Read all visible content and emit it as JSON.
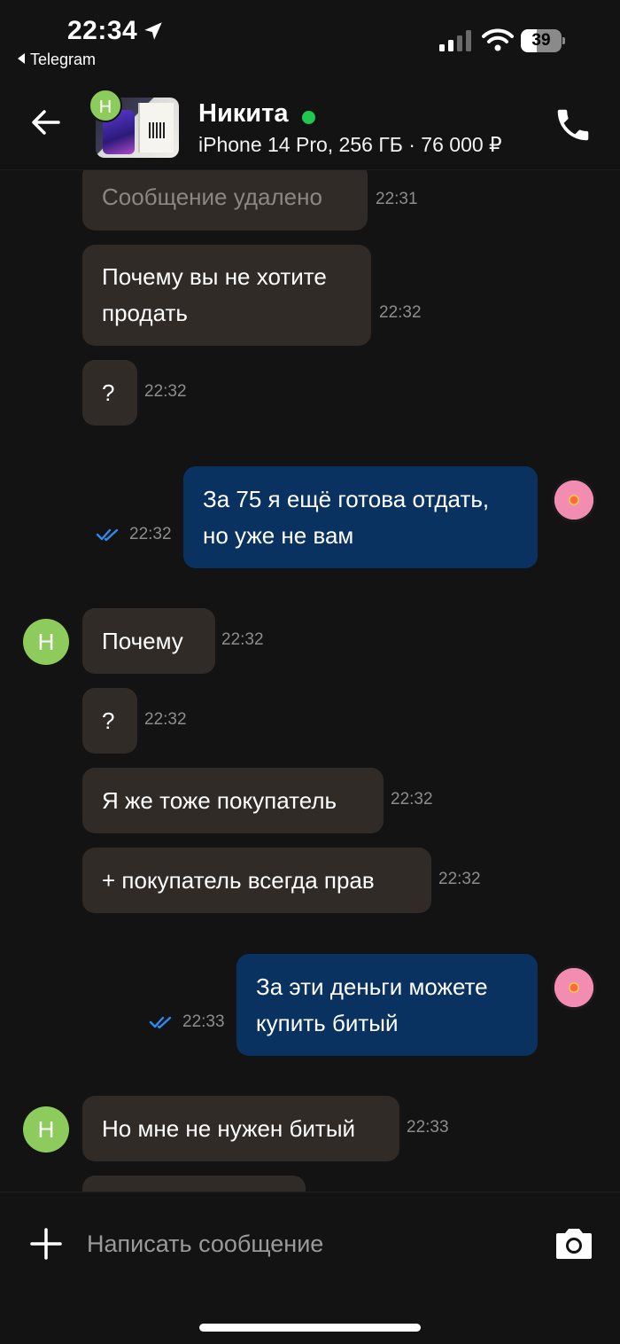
{
  "status_bar": {
    "time": "22:34",
    "back_app": "Telegram",
    "battery_level": "39",
    "battery_fraction": 0.39
  },
  "header": {
    "name": "Никита",
    "listing": "iPhone 14 Pro, 256 ГБ · 76 000 ₽",
    "badge_letter": "Н"
  },
  "messages": [
    {
      "dir": "in",
      "text": "Сообщение удалено",
      "time": "22:31",
      "deleted": true
    },
    {
      "dir": "in",
      "text": "Почему вы не хотите продать",
      "time": "22:32"
    },
    {
      "dir": "in",
      "text": "?",
      "time": "22:32"
    },
    {
      "dir": "out",
      "text": "За 75 я ещё готова отдать, но уже не вам",
      "time": "22:32",
      "status": "read"
    },
    {
      "dir": "in",
      "text": "Почему",
      "time": "22:32",
      "avatar": "Н"
    },
    {
      "dir": "in",
      "text": "?",
      "time": "22:32"
    },
    {
      "dir": "in",
      "text": "Я же тоже покупатель",
      "time": "22:32"
    },
    {
      "dir": "in",
      "text": "+ покупатель всегда прав",
      "time": "22:32"
    },
    {
      "dir": "out",
      "text": "За эти деньги можете купить битый",
      "time": "22:33",
      "status": "read"
    },
    {
      "dir": "in",
      "text": "Но мне не нужен битый",
      "time": "22:33",
      "avatar": "Н"
    }
  ],
  "composer": {
    "placeholder": "Написать сообщение"
  },
  "colors": {
    "background": "#131313",
    "incoming_bubble": "#302b27",
    "outgoing_bubble": "#0a3260",
    "online": "#1fc94f",
    "avatar": "#8dcc5c",
    "read_ticks": "#2b8cf0"
  }
}
